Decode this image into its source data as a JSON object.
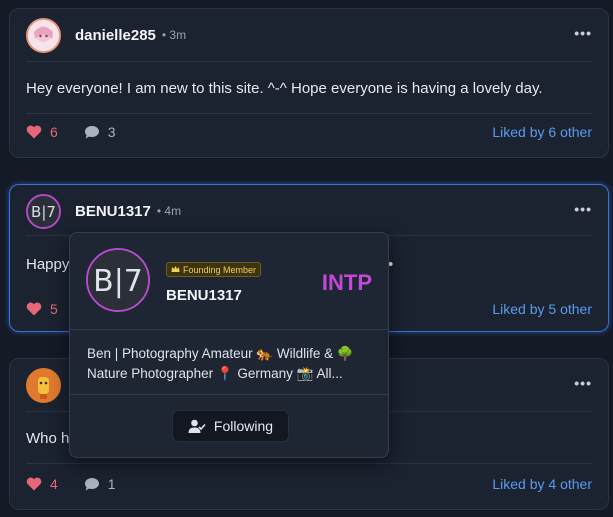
{
  "posts": [
    {
      "username": "danielle285",
      "time": "• 3m",
      "text": "Hey everyone! I am new to this site. ^-^ Hope everyone is having a lovely day.",
      "likes": "6",
      "comments": "3",
      "liked_by": "Liked by 6 other"
    },
    {
      "username": "BENU1317",
      "time": "• 4m",
      "text": "Happy",
      "text_tail": "•",
      "likes": "5",
      "liked_by": "Liked by 5 other"
    },
    {
      "text": "Who h",
      "likes": "4",
      "comments": "1",
      "liked_by": "Liked by 4 other"
    }
  ],
  "more_label": "•••",
  "popup": {
    "avatar_text": "B|7",
    "badge": "Founding Member",
    "name": "BENU1317",
    "mbti": "INTP",
    "bio_line1": "Ben | Photography Amateur 🐅 Wildlife & 🌳",
    "bio_line2": "Nature Photographer 📍 Germany 📸 All...",
    "follow_label": "Following"
  },
  "colors": {
    "accent_link": "#5b9bef",
    "like": "#e5677a",
    "mbti": "#c448d6",
    "badge_text": "#f1cf5a"
  }
}
